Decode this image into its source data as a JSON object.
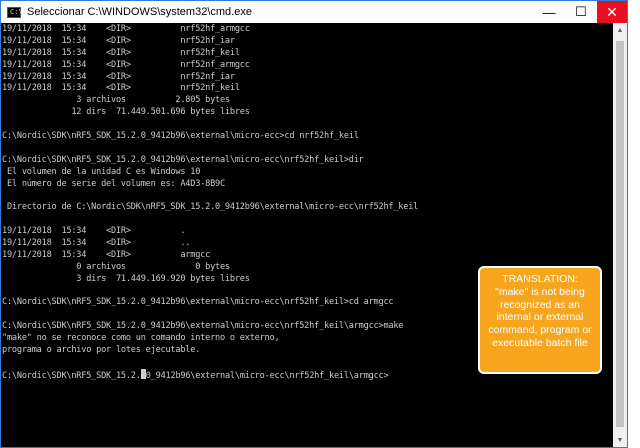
{
  "window": {
    "title": "Seleccionar C:\\WINDOWS\\system32\\cmd.exe",
    "icon_text": "C:\\",
    "controls": {
      "minimize": "—",
      "maximize": "☐",
      "close": "✕"
    }
  },
  "console_lines": [
    "19/11/2018  15:34    <DIR>          nrf52hf_armgcc",
    "19/11/2018  15:34    <DIR>          nrf52hf_iar",
    "19/11/2018  15:34    <DIR>          nrf52hf_keil",
    "19/11/2018  15:34    <DIR>          nrf52nf_armgcc",
    "19/11/2018  15:34    <DIR>          nrf52nf_iar",
    "19/11/2018  15:34    <DIR>          nrf52nf_keil",
    "               3 archivos          2.805 bytes",
    "              12 dirs  71.449.501.696 bytes libres",
    "",
    "C:\\Nordic\\SDK\\nRF5_SDK_15.2.0_9412b96\\external\\micro-ecc>cd nrf52hf_keil",
    "",
    "C:\\Nordic\\SDK\\nRF5_SDK_15.2.0_9412b96\\external\\micro-ecc\\nrf52hf_keil>dir",
    " El volumen de la unidad C es Windows 10",
    " El número de serie del volumen es: A4D3-8B9C",
    "",
    " Directorio de C:\\Nordic\\SDK\\nRF5_SDK_15.2.0_9412b96\\external\\micro-ecc\\nrf52hf_keil",
    "",
    "19/11/2018  15:34    <DIR>          .",
    "19/11/2018  15:34    <DIR>          ..",
    "19/11/2018  15:34    <DIR>          armgcc",
    "               0 archivos              0 bytes",
    "               3 dirs  71.449.169.920 bytes libres",
    "",
    "C:\\Nordic\\SDK\\nRF5_SDK_15.2.0_9412b96\\external\\micro-ecc\\nrf52hf_keil>cd armgcc",
    "",
    "C:\\Nordic\\SDK\\nRF5_SDK_15.2.0_9412b96\\external\\micro-ecc\\nrf52hf_keil\\armgcc>make",
    "\"make\" no se reconoce como un comando interno o externo,",
    "programa o archivo por lotes ejecutable.",
    ""
  ],
  "prompt": {
    "before_cursor": "C:\\Nordic\\SDK\\nRF5_SDK_15.2.",
    "after_cursor": "0_9412b96\\external\\micro-ecc\\nrf52hf_keil\\armgcc>"
  },
  "callout": {
    "heading": "TRANSLATION:",
    "body": "\"make\" is not being recognized as an internal or external command, program or executable batch file"
  },
  "colors": {
    "console_bg": "#000000",
    "console_text": "#cccccc",
    "close_button": "#e81123",
    "callout_bg": "#f7a51d"
  }
}
